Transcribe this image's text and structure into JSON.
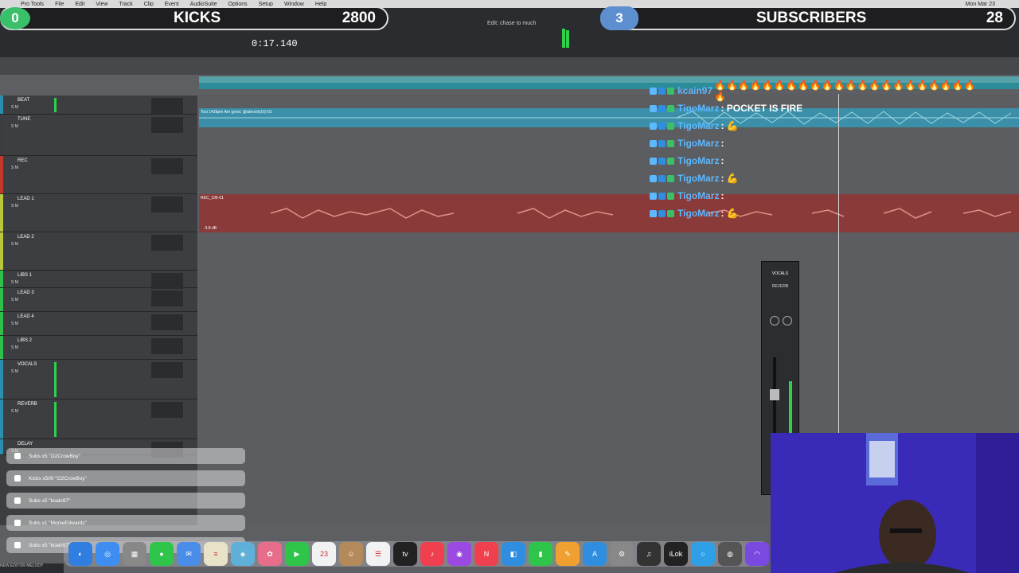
{
  "menubar": {
    "items": [
      "Pro Tools",
      "File",
      "Edit",
      "View",
      "Track",
      "Clip",
      "Event",
      "AudioSuite",
      "Options",
      "Setup",
      "Window",
      "Help"
    ],
    "clock": "Mon Mar 23"
  },
  "overlay": {
    "kicks": {
      "bubble": "0",
      "title": "KICKS",
      "count": "2800"
    },
    "subscribers": {
      "bubble": "3",
      "title": "SUBSCRIBERS",
      "count": "28"
    }
  },
  "transport": {
    "counter": "0:17.140",
    "edit_status": "Edit: chase to much"
  },
  "tracks": [
    {
      "name": "BEAT",
      "color": "#2a8fae"
    },
    {
      "name": "TUNE",
      "color": "#3b3c40"
    },
    {
      "name": "REC",
      "color": "#c0392b"
    },
    {
      "name": "LEAD 1",
      "color": "#b8c83a"
    },
    {
      "name": "LEAD 2",
      "color": "#b8c83a"
    },
    {
      "name": "LIBS 1",
      "color": "#2fbf4a"
    },
    {
      "name": "LEAD 3",
      "color": "#2fbf4a"
    },
    {
      "name": "LEAD 4",
      "color": "#2fbf4a"
    },
    {
      "name": "LIBS 2",
      "color": "#2fbf4a"
    },
    {
      "name": "VOCALS",
      "color": "#2a8fae"
    },
    {
      "name": "REVERB",
      "color": "#2a8fae"
    },
    {
      "name": "DELAY",
      "color": "#2a8fae"
    }
  ],
  "clips": {
    "beat": "Toxi 142bpm Am (prod. @abrocity16)-01",
    "rec": "REC_106-01",
    "rec_gain": "-3.8 dB"
  },
  "chat": [
    {
      "user": "kcain97",
      "msg": "🔥🔥🔥🔥🔥🔥🔥🔥🔥🔥🔥🔥🔥🔥🔥🔥🔥🔥🔥🔥🔥🔥🔥"
    },
    {
      "user": "TigoMarz",
      "msg": ": POCKET IS FIRE"
    },
    {
      "user": "TigoMarz",
      "msg": ": 💪"
    },
    {
      "user": "TigoMarz",
      "msg": ":"
    },
    {
      "user": "TigoMarz",
      "msg": ":"
    },
    {
      "user": "TigoMarz",
      "msg": ": 💪"
    },
    {
      "user": "TigoMarz",
      "msg": ":"
    },
    {
      "user": "TigoMarz",
      "msg": ": 💪"
    }
  ],
  "mixer": {
    "name": "VOCALS",
    "insert": "REVERB"
  },
  "notifications": [
    "Subs x5 \"O2CrowBoy\"",
    "Kicks x500 \"O2CrowBoy\"",
    "Subs x5 \"kcain97\"",
    "Subs x1 \"MonieEdwards\"",
    "Subs x5 \"kcain97\""
  ],
  "dock": [
    {
      "name": "finder-icon",
      "color": "#2f7ee0",
      "label": "◐"
    },
    {
      "name": "safari-icon",
      "color": "#3d8ef0",
      "label": "◎"
    },
    {
      "name": "launchpad-icon",
      "color": "#888",
      "label": "▦"
    },
    {
      "name": "messages-icon",
      "color": "#2fc44a",
      "label": "●"
    },
    {
      "name": "mail-icon",
      "color": "#4a8de8",
      "label": "✉"
    },
    {
      "name": "notes-icon",
      "color": "#e8e3c8",
      "label": "≡"
    },
    {
      "name": "maps-icon",
      "color": "#5fb0d8",
      "label": "◈"
    },
    {
      "name": "photos-icon",
      "color": "#e86d8a",
      "label": "✿"
    },
    {
      "name": "facetime-icon",
      "color": "#2fc44a",
      "label": "▶"
    },
    {
      "name": "calendar-icon",
      "color": "#f2f2f2",
      "label": "23"
    },
    {
      "name": "contacts-icon",
      "color": "#b58a5a",
      "label": "☺"
    },
    {
      "name": "reminders-icon",
      "color": "#f2f2f2",
      "label": "☰"
    },
    {
      "name": "tv-icon",
      "color": "#222",
      "label": "tv"
    },
    {
      "name": "music-icon",
      "color": "#f04050",
      "label": "♪"
    },
    {
      "name": "podcasts-icon",
      "color": "#9a4ae0",
      "label": "◉"
    },
    {
      "name": "news-icon",
      "color": "#f04050",
      "label": "N"
    },
    {
      "name": "keynote-icon",
      "color": "#2f8ee0",
      "label": "◧"
    },
    {
      "name": "numbers-icon",
      "color": "#2fc44a",
      "label": "▮"
    },
    {
      "name": "pages-icon",
      "color": "#f0a030",
      "label": "✎"
    },
    {
      "name": "appstore-icon",
      "color": "#2f8ee0",
      "label": "A"
    },
    {
      "name": "settings-icon",
      "color": "#888",
      "label": "⚙"
    },
    {
      "name": "garageband-icon",
      "color": "#333",
      "label": "♫"
    },
    {
      "name": "ilok-icon",
      "color": "#222",
      "label": "iLok"
    },
    {
      "name": "circle-app-icon",
      "color": "#2fa0e8",
      "label": "○"
    },
    {
      "name": "audio-app-icon",
      "color": "#555",
      "label": "◍"
    },
    {
      "name": "protools-icon",
      "color": "#7a4ae0",
      "label": "◠"
    }
  ],
  "bottom": "NEW EDITOR MELODY"
}
